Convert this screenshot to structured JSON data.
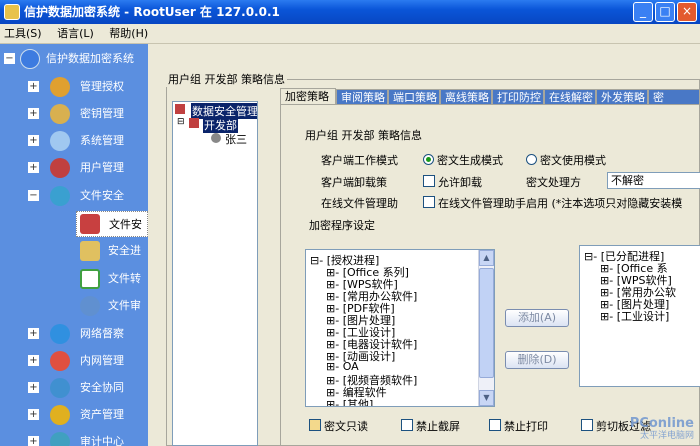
{
  "window": {
    "title": "信护数据加密系统 - RootUser 在 127.0.0.1",
    "min": "_",
    "max": "□",
    "close": "×"
  },
  "menu": [
    "工具(S)",
    "语言(L)",
    "帮助(H)"
  ],
  "nav": {
    "root": "信护数据加密系统",
    "items": [
      "管理授权",
      "密钥管理",
      "系统管理",
      "用户管理",
      "文件安全",
      "网络督察",
      "内网管理",
      "安全协同",
      "资产管理",
      "审计中心"
    ],
    "sub": [
      "文件安",
      "安全进",
      "文件转",
      "文件审"
    ]
  },
  "main": {
    "breadcrumb": "用户组 开发部 策略信息",
    "tree": {
      "root": "数据安全管理",
      "group": "开发部",
      "user": "张三"
    },
    "tabs": [
      "加密策略",
      "审阅策略",
      "端口策略",
      "离线策略",
      "打印防控",
      "在线解密",
      "外发策略",
      "密"
    ],
    "panel": {
      "heading": "用户组 开发部 策略信息",
      "client_mode_label": "客户端工作模式",
      "mode_encrypt": "密文生成模式",
      "mode_use": "密文使用模式",
      "uninstall_label": "客户端卸载策",
      "allow_uninstall": "允许卸载",
      "cipher_label": "密文处理方",
      "cipher_value": "不解密",
      "online_label": "在线文件管理助",
      "online_check": "在线文件管理助手启用 (*注本选项只对隐藏安装模",
      "program_label": "加密程序设定",
      "left_list": [
        "[授权进程]",
        "[Office 系列]",
        "[WPS软件]",
        "[常用办公软件]",
        "[PDF软件]",
        "[图片处理]",
        "[工业设计]",
        "[电器设计软件]",
        "[动画设计]",
        "OA",
        "[视频音频软件]",
        "编程软件",
        "[其他]"
      ],
      "right_list": [
        "[已分配进程]",
        "[Office 系",
        "[WPS软件]",
        "[常用办公软",
        "[图片处理]",
        "[工业设计]"
      ],
      "add_btn": "添加(A)",
      "del_btn": "删除(D)",
      "checks": [
        "密文只读",
        "禁止截屏",
        "禁止打印",
        "剪切板过滤"
      ]
    }
  },
  "watermark": {
    "brand": "PConline",
    "sub": "太平洋电脑网"
  }
}
